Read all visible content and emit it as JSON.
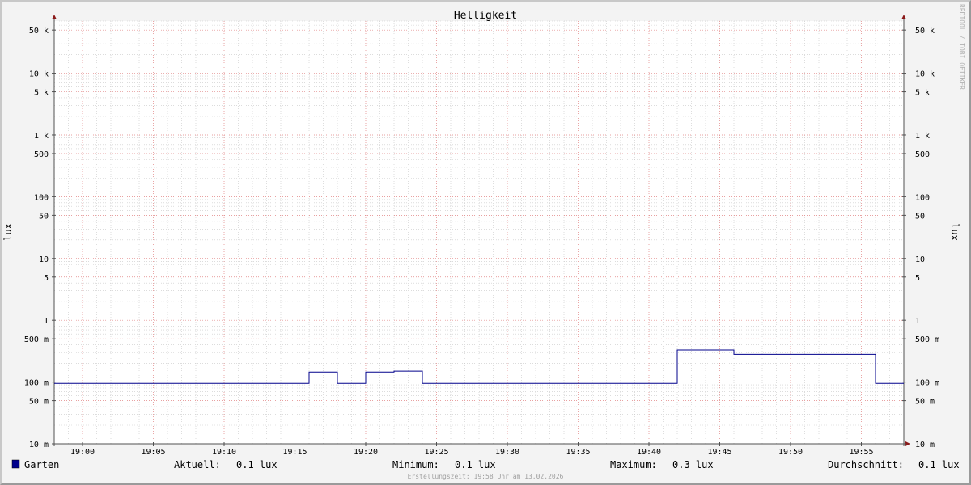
{
  "chart_data": {
    "type": "line",
    "title": "Helligkeit",
    "ylabel": "lux",
    "yscale": "log",
    "ylim": [
      0.01,
      70000
    ],
    "xlim": [
      "18:58",
      "19:58"
    ],
    "y_tick_labels": [
      {
        "value": 50000,
        "label": "50 k"
      },
      {
        "value": 10000,
        "label": "10 k"
      },
      {
        "value": 5000,
        "label": "5 k"
      },
      {
        "value": 1000,
        "label": "1 k"
      },
      {
        "value": 500,
        "label": "500"
      },
      {
        "value": 100,
        "label": "100"
      },
      {
        "value": 50,
        "label": "50"
      },
      {
        "value": 10,
        "label": "10"
      },
      {
        "value": 5,
        "label": "5"
      },
      {
        "value": 1,
        "label": "1"
      },
      {
        "value": 0.5,
        "label": "500 m"
      },
      {
        "value": 0.1,
        "label": "100 m"
      },
      {
        "value": 0.05,
        "label": "50 m"
      },
      {
        "value": 0.01,
        "label": "10 m"
      }
    ],
    "x_tick_labels": [
      "19:00",
      "19:05",
      "19:10",
      "19:15",
      "19:20",
      "19:25",
      "19:30",
      "19:35",
      "19:40",
      "19:45",
      "19:50",
      "19:55"
    ],
    "series": [
      {
        "name": "Garten",
        "color": "#00008b",
        "points": [
          [
            "18:58",
            0.095
          ],
          [
            "19:16",
            0.095
          ],
          [
            "19:16",
            0.145
          ],
          [
            "19:18",
            0.145
          ],
          [
            "19:18",
            0.095
          ],
          [
            "19:20",
            0.095
          ],
          [
            "19:20",
            0.145
          ],
          [
            "19:22",
            0.145
          ],
          [
            "19:22",
            0.15
          ],
          [
            "19:24",
            0.15
          ],
          [
            "19:24",
            0.095
          ],
          [
            "19:42",
            0.095
          ],
          [
            "19:42",
            0.33
          ],
          [
            "19:46",
            0.33
          ],
          [
            "19:46",
            0.28
          ],
          [
            "19:56",
            0.28
          ],
          [
            "19:56",
            0.095
          ],
          [
            "19:58",
            0.095
          ]
        ]
      }
    ],
    "grid": true,
    "legend_position": "bottom-left"
  },
  "legend": {
    "swatch_color": "#00008b",
    "series_name": "Garten",
    "current_label": "Aktuell:",
    "current_value": "0.1 lux",
    "min_label": "Minimum:",
    "min_value": "0.1 lux",
    "max_label": "Maximum:",
    "max_value": "0.3 lux",
    "avg_label": "Durchschnitt:",
    "avg_value": "0.1 lux"
  },
  "footer": {
    "created_text": "Erstellungszeit: 19:58 Uhr am 13.02.2026"
  },
  "watermark": "RRDTOOL / TOBI OETIKER",
  "colors": {
    "background": "#f3f3f3",
    "plot_background": "#ffffff",
    "major_grid": "#e08080",
    "minor_grid": "#c8c8c8",
    "axis": "#505050",
    "arrow": "#8b1a1a",
    "line": "#00008b"
  }
}
